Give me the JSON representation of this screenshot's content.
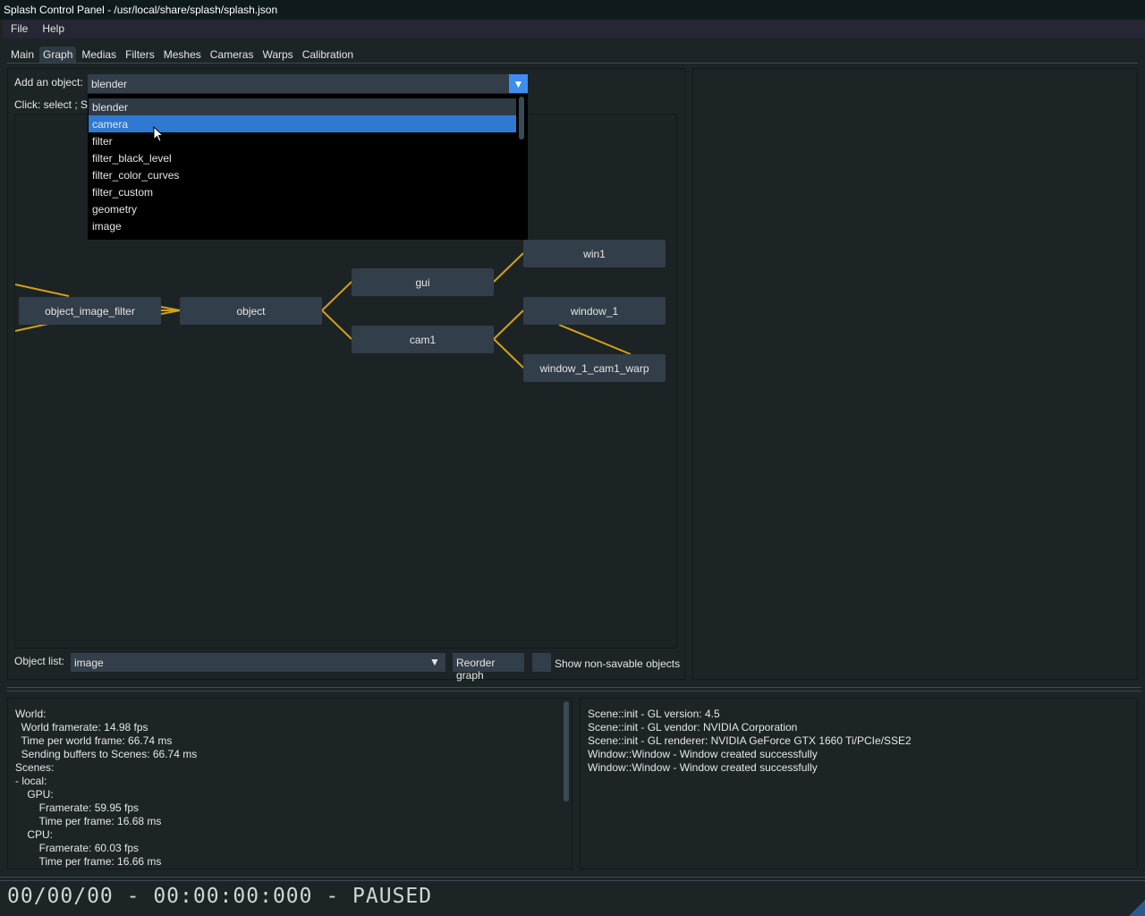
{
  "window_title": "Splash Control Panel - /usr/local/share/splash/splash.json",
  "menu": [
    "File",
    "Help"
  ],
  "tabs": [
    {
      "label": "Main"
    },
    {
      "label": "Graph",
      "active": true
    },
    {
      "label": "Medias"
    },
    {
      "label": "Filters"
    },
    {
      "label": "Meshes"
    },
    {
      "label": "Cameras"
    },
    {
      "label": "Warps"
    },
    {
      "label": "Calibration"
    }
  ],
  "graph_tab": {
    "add_object_label": "Add an object:",
    "add_object_value": "blender",
    "help_text_partial": "Click: select ; Sh",
    "dropdown_options": [
      "blender",
      "camera",
      "filter",
      "filter_black_level",
      "filter_color_curves",
      "filter_custom",
      "geometry",
      "image"
    ],
    "dropdown_highlighted": "camera",
    "dropdown_hovered": "blender",
    "nodes": [
      {
        "id": "object_image_filter",
        "label": "object_image_filter"
      },
      {
        "id": "object",
        "label": "object"
      },
      {
        "id": "gui",
        "label": "gui"
      },
      {
        "id": "cam1",
        "label": "cam1"
      },
      {
        "id": "win1",
        "label": "win1"
      },
      {
        "id": "window_1",
        "label": "window_1"
      },
      {
        "id": "window_1_cam1_warp",
        "label": "window_1_cam1_warp"
      }
    ],
    "edges": [
      [
        "object_image_filter",
        "object"
      ],
      [
        "object",
        "gui"
      ],
      [
        "object",
        "cam1"
      ],
      [
        "gui",
        "win1"
      ],
      [
        "cam1",
        "window_1"
      ],
      [
        "cam1",
        "window_1_cam1_warp"
      ],
      [
        "window_1",
        "window_1_cam1_warp"
      ]
    ],
    "edge_color": "#d4a017",
    "object_list_label": "Object list:",
    "object_list_value": "image",
    "reorder_label": "Reorder graph",
    "show_nonsavable_label": "Show non-savable objects",
    "show_nonsavable_checked": false
  },
  "stats": [
    "World:",
    "  World framerate: 14.98 fps",
    "  Time per world frame: 66.74 ms",
    "  Sending buffers to Scenes: 66.74 ms",
    "Scenes:",
    "- local:",
    "    GPU:",
    "        Framerate: 59.95 fps",
    "        Time per frame: 16.68 ms",
    "    CPU:",
    "        Framerate: 60.03 fps",
    "        Time per frame: 16.66 ms"
  ],
  "log": [
    "Scene::init - GL version: 4.5",
    "Scene::init - GL vendor: NVIDIA Corporation",
    "Scene::init - GL renderer: NVIDIA GeForce GTX 1660 Ti/PCIe/SSE2",
    "Window::Window - Window created successfully",
    "Window::Window - Window created successfully"
  ],
  "status": "00/00/00 - 00:00:00:000 - PAUSED",
  "accent_color": "#3d8ef0"
}
